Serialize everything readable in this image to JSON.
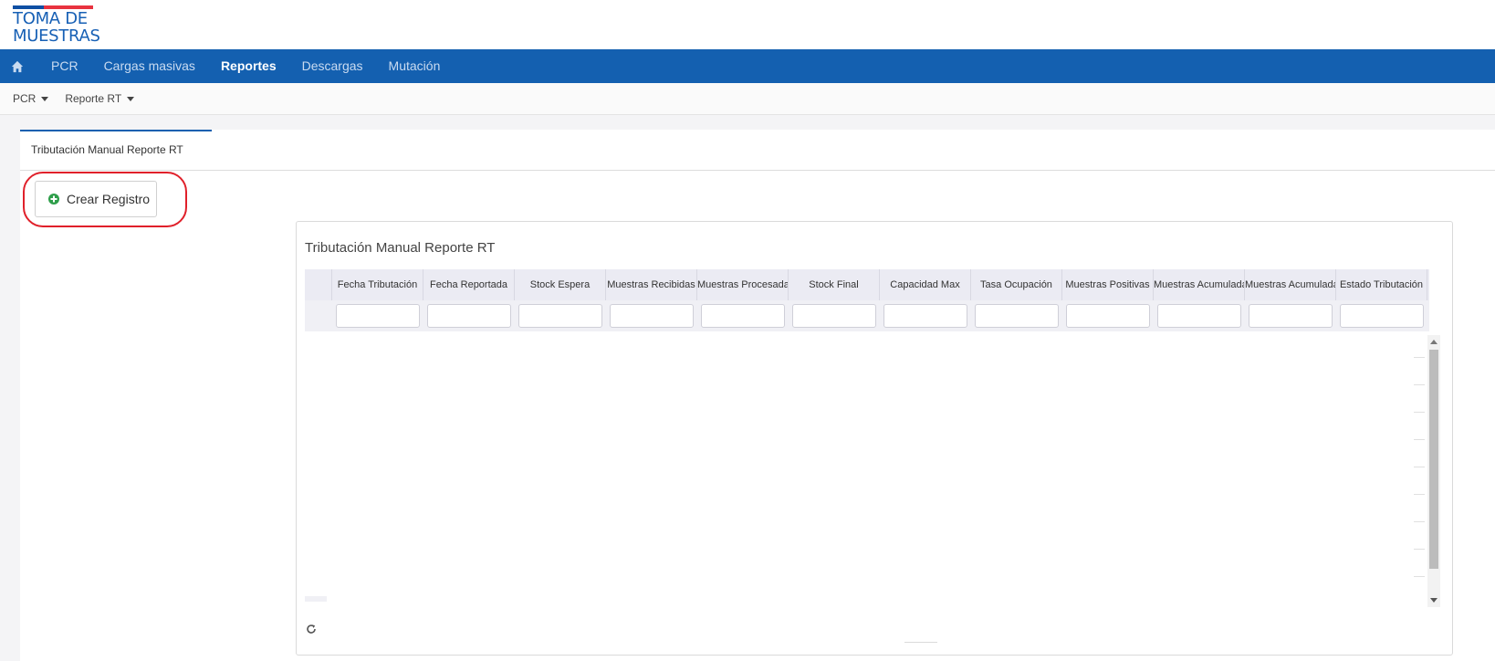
{
  "logo": {
    "line1": "TOMA DE",
    "line2": "MUESTRAS",
    "stripe_colors": [
      "#0f4fa3",
      "#e8333f"
    ]
  },
  "main_nav": {
    "home_icon": "home-icon",
    "items": [
      {
        "label": "PCR",
        "active": false
      },
      {
        "label": "Cargas masivas",
        "active": false
      },
      {
        "label": "Reportes",
        "active": true
      },
      {
        "label": "Descargas",
        "active": false
      },
      {
        "label": "Mutación",
        "active": false
      }
    ],
    "background": "#1460b0"
  },
  "sub_nav": {
    "items": [
      {
        "label": "PCR"
      },
      {
        "label": "Reporte RT"
      }
    ]
  },
  "tab": {
    "label": "Tributación Manual Reporte RT"
  },
  "toolbar": {
    "create_label": "Crear Registro",
    "create_icon": "plus-circle-icon"
  },
  "grid": {
    "title": "Tributación Manual Reporte RT",
    "columns": [
      "Fecha Tributación",
      "Fecha Reportada",
      "Stock Espera",
      "Muestras Recibidas",
      "Muestras Procesadas",
      "Stock Final",
      "Capacidad Max",
      "Tasa Ocupación",
      "Muestras Positivas",
      "Muestras Acumuladas",
      "Muestras Acumuladas",
      "Estado Tributación"
    ],
    "filters": [
      "",
      "",
      "",
      "",
      "",
      "",
      "",
      "",
      "",
      "",
      "",
      ""
    ],
    "refresh_icon": "refresh-icon"
  },
  "highlight_color": "#e0202a"
}
